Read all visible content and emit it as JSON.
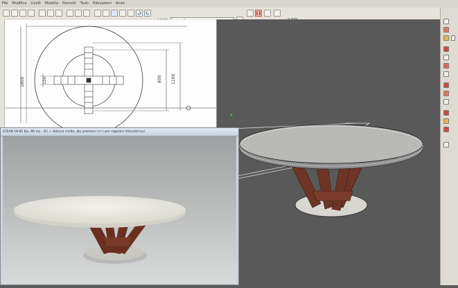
{
  "menu": {
    "items": [
      "File",
      "Modifica",
      "Livelli",
      "Modella",
      "Pannelli",
      "Tools",
      "Rilevazioni",
      "Aiuto"
    ]
  },
  "toolbar": {
    "layer_label": "Layer",
    "layer_value": "Layer 1",
    "view_mode": "X-RAY"
  },
  "drawing": {
    "dimensions": {
      "overall_height": "1800",
      "inner_150": "150",
      "inner_800": "800",
      "inner_1100": "1100"
    }
  },
  "render_window": {
    "title": "STEAN 18.81 fps, 80 ms - (E) = sblocca scelta, qtv premere (+/-) per regolare intensità luci"
  },
  "colors": {
    "table_top": "#e9e7df",
    "wood": "#6e3526",
    "viewport_bg": "#595959",
    "accent_red": "#c94c3a"
  }
}
